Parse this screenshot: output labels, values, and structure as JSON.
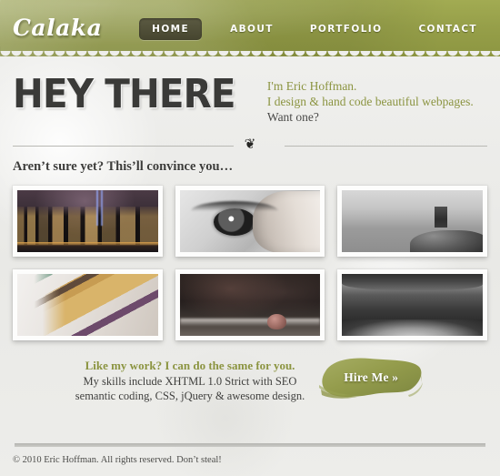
{
  "site": {
    "logo": "Calaka"
  },
  "nav": {
    "items": [
      {
        "label": "HOME",
        "active": true
      },
      {
        "label": "ABOUT",
        "active": false
      },
      {
        "label": "PORTFOLIO",
        "active": false
      },
      {
        "label": "CONTACT",
        "active": false
      }
    ]
  },
  "hero": {
    "headline": "HEY THERE",
    "intro_line1": "I'm Eric Hoffman.",
    "intro_line2": "I design & hand code beautiful webpages.",
    "intro_line3": "Want one?"
  },
  "divider": {
    "ornament": "❦"
  },
  "subhead": {
    "text": "Aren’t sure yet? This’ll convince you…"
  },
  "gallery": {
    "items": [
      {
        "name": "city-skyline-night",
        "alt": "City skyline at night with light beams"
      },
      {
        "name": "eye-closeup",
        "alt": "Black and white close-up of an eye with hand"
      },
      {
        "name": "sea-post-long-exposure",
        "alt": "Black and white seascape with stone post and rocks"
      },
      {
        "name": "coloured-pencils",
        "alt": "Close-up of sharpened coloured pencils"
      },
      {
        "name": "blurred-rose",
        "alt": "Dark blurred scene with a small rose"
      },
      {
        "name": "lake-landscape",
        "alt": "Black and white lake and marsh landscape"
      }
    ]
  },
  "cta": {
    "lead": "Like my work? I can do the same for you.",
    "line2": "My skills include XHTML 1.0 Strict with SEO",
    "line3": "semantic coding, CSS, jQuery & awesome design.",
    "button_label": "Hire Me »"
  },
  "footer": {
    "copyright": "© 2010 Eric Hoffman. All rights reserved. Don’t steal!"
  },
  "colors": {
    "header_olive": "#959e48",
    "accent_olive": "#8b9440",
    "nav_active_bg": "#4b4b37",
    "page_bg": "#eeeeec",
    "heading_dark": "#3a3a38"
  }
}
